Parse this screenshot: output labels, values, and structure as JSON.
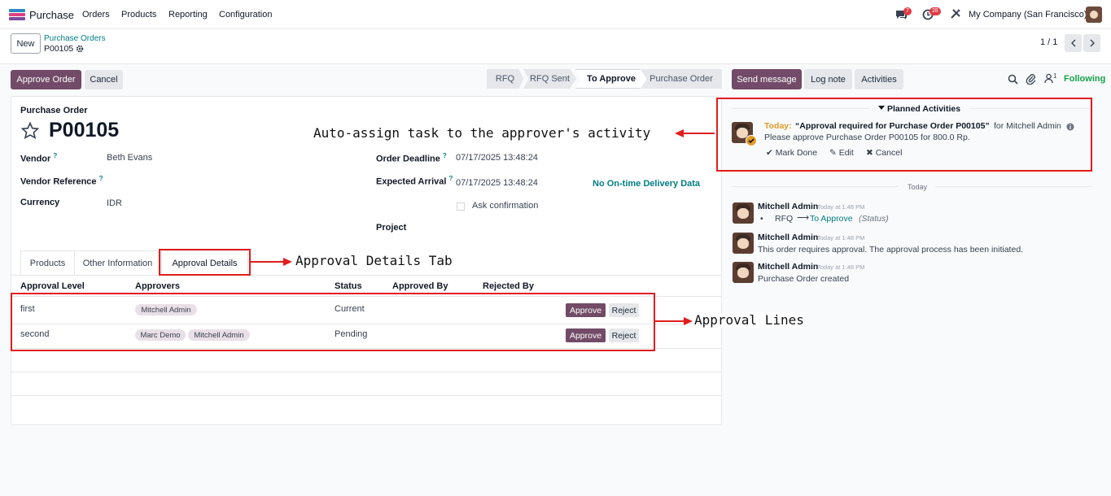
{
  "navbar": {
    "app_name": "Purchase",
    "menu": [
      "Orders",
      "Products",
      "Reporting",
      "Configuration"
    ],
    "messages_count": "7",
    "activities_count": "28",
    "company": "My Company (San Francisco)"
  },
  "control": {
    "new_label": "New",
    "breadcrumb_parent": "Purchase Orders",
    "record_name": "P00105",
    "pager": "1 / 1"
  },
  "actions": {
    "approve_order": "Approve Order",
    "cancel": "Cancel"
  },
  "statusbar": [
    "RFQ",
    "RFQ Sent",
    "To Approve",
    "Purchase Order"
  ],
  "form": {
    "header_label": "Purchase Order",
    "order_name": "P00105",
    "vendor_label": "Vendor",
    "vendor_value": "Beth Evans",
    "vendor_ref_label": "Vendor Reference",
    "currency_label": "Currency",
    "currency_value": "IDR",
    "order_deadline_label": "Order Deadline",
    "order_deadline_value": "07/17/2025 13:48:24",
    "expected_arrival_label": "Expected Arrival",
    "expected_arrival_value": "07/17/2025 13:48:24",
    "ontime_link": "No On-time Delivery Data",
    "ask_confirmation": "Ask confirmation",
    "project_label": "Project",
    "help_mark": "?"
  },
  "tabs": [
    "Products",
    "Other Information",
    "Approval Details"
  ],
  "approval_table": {
    "headers": [
      "Approval Level",
      "Approvers",
      "Status",
      "Approved By",
      "Rejected By"
    ],
    "rows": [
      {
        "level": "first",
        "approvers": [
          "Mitchell Admin"
        ],
        "status": "Current"
      },
      {
        "level": "second",
        "approvers": [
          "Marc Demo",
          "Mitchell Admin"
        ],
        "status": "Pending"
      }
    ],
    "approve_label": "Approve",
    "reject_label": "Reject"
  },
  "chatter": {
    "send_message": "Send message",
    "log_note": "Log note",
    "activities": "Activities",
    "follower_count": "1",
    "following": "Following",
    "planned_activities": "Planned Activities",
    "activity": {
      "when": "Today:",
      "summary": "“Approval required for Purchase Order P00105”",
      "assignee": "for Mitchell Admin",
      "note": "Please approve Purchase Order P00105 for 800.0 Rp.",
      "mark_done": "Mark Done",
      "edit": "Edit",
      "cancel": "Cancel"
    },
    "date_separator": "Today",
    "messages": [
      {
        "author": "Mitchell Admin",
        "time": "Today at 1:48 PM",
        "tracking_from": "RFQ",
        "tracking_to": "To Approve",
        "tracking_field": "(Status)"
      },
      {
        "author": "Mitchell Admin",
        "time": "Today at 1:48 PM",
        "body": "This order requires approval. The approval process has been initiated."
      },
      {
        "author": "Mitchell Admin",
        "time": "Today at 1:48 PM",
        "body": "Purchase Order created"
      }
    ]
  },
  "annotations": {
    "activity": "Auto-assign task to the approver's activity",
    "tab": "Approval Details Tab",
    "lines": "Approval Lines"
  },
  "colors": {
    "primary": "#714b67",
    "link": "#017e84",
    "annotation": "#e11d1d",
    "today": "#e49a2a"
  }
}
